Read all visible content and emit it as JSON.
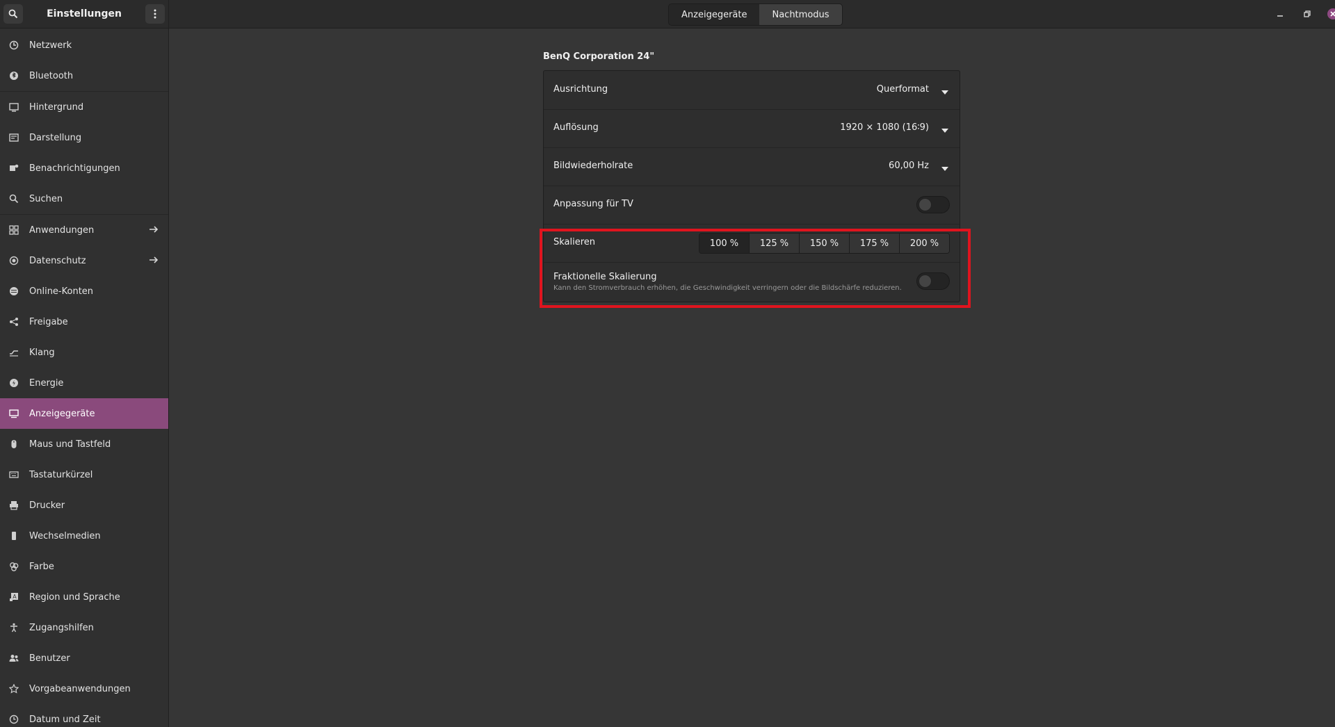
{
  "app": {
    "title": "Einstellungen"
  },
  "sidebar": {
    "items": [
      {
        "label": "Netzwerk",
        "icon": "network-icon"
      },
      {
        "label": "Bluetooth",
        "icon": "bluetooth-icon"
      },
      {
        "label": "Hintergrund",
        "icon": "wallpaper-icon"
      },
      {
        "label": "Darstellung",
        "icon": "appearance-icon"
      },
      {
        "label": "Benachrichtigungen",
        "icon": "notification-icon"
      },
      {
        "label": "Suchen",
        "icon": "search-icon"
      },
      {
        "label": "Anwendungen",
        "icon": "apps-icon",
        "arrow": true
      },
      {
        "label": "Datenschutz",
        "icon": "privacy-icon",
        "arrow": true
      },
      {
        "label": "Online-Konten",
        "icon": "online-accounts-icon"
      },
      {
        "label": "Freigabe",
        "icon": "share-icon"
      },
      {
        "label": "Klang",
        "icon": "sound-icon"
      },
      {
        "label": "Energie",
        "icon": "power-icon"
      },
      {
        "label": "Anzeigegeräte",
        "icon": "display-icon",
        "active": true
      },
      {
        "label": "Maus und Tastfeld",
        "icon": "mouse-icon"
      },
      {
        "label": "Tastaturkürzel",
        "icon": "keyboard-icon"
      },
      {
        "label": "Drucker",
        "icon": "printer-icon"
      },
      {
        "label": "Wechselmedien",
        "icon": "removable-media-icon"
      },
      {
        "label": "Farbe",
        "icon": "color-icon"
      },
      {
        "label": "Region und Sprache",
        "icon": "region-icon"
      },
      {
        "label": "Zugangshilfen",
        "icon": "accessibility-icon"
      },
      {
        "label": "Benutzer",
        "icon": "users-icon"
      },
      {
        "label": "Vorgabeanwendungen",
        "icon": "star-icon"
      },
      {
        "label": "Datum und Zeit",
        "icon": "clock-icon"
      }
    ]
  },
  "header": {
    "tabs": [
      {
        "label": "Anzeigegeräte",
        "selected": true
      },
      {
        "label": "Nachtmodus",
        "selected": false
      }
    ]
  },
  "display": {
    "monitor_name": "BenQ Corporation 24\"",
    "orientation": {
      "label": "Ausrichtung",
      "value": "Querformat"
    },
    "resolution": {
      "label": "Auflösung",
      "value": "1920 × 1080 (16∶9)"
    },
    "refresh_rate": {
      "label": "Bildwiederholrate",
      "value": "60,00 Hz"
    },
    "tv_adjust": {
      "label": "Anpassung für TV",
      "enabled": false
    },
    "scale": {
      "label": "Skalieren",
      "options": [
        "100 %",
        "125 %",
        "150 %",
        "175 %",
        "200 %"
      ],
      "selected": "100 %"
    },
    "fractional_scaling": {
      "label": "Fraktionelle Skalierung",
      "description": "Kann den Stromverbrauch erhöhen, die Geschwindigkeit verringern oder die Bildschärfe reduzieren.",
      "enabled": false
    }
  },
  "colors": {
    "accent": "#8a4a7c",
    "highlight": "#e0141e",
    "close_button": "#8e4a82"
  }
}
